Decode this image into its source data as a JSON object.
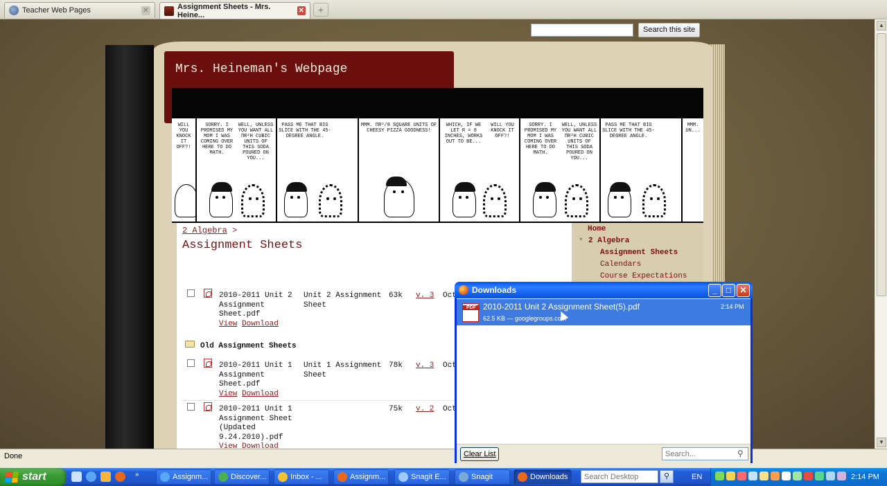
{
  "browser": {
    "tabs": [
      {
        "label": "Teacher Web Pages",
        "active": false
      },
      {
        "label": "Assignment Sheets - Mrs. Heine...",
        "active": true
      }
    ],
    "new_tab_label": "+",
    "status": "Done"
  },
  "site": {
    "search_button": "Search this site",
    "title": "Mrs. Heineman's Webpage",
    "comic_panels": [
      "will you knock it off?!",
      "Sorry. I promised my mom I was coming over here to do math.",
      "Well, unless you want all πr²h cubic units of this soda poured on you...",
      "Pass me that big slice with the 45-degree angle.",
      "Mmm. πr²/8 square units of cheesy pizza goodness!",
      "Which, if we let r = 8 inches, works out to be...",
      "Will you knock it off?!",
      "Sorry. I promised my mom I was coming over here to do math.",
      "Well, unless you want all πr²h cubic units of this soda poured on you...",
      "Pass me that big slice with the 45-degree angle.",
      "Mmm. un..."
    ]
  },
  "breadcrumb": {
    "parent": "2 Algebra",
    "separator": ">"
  },
  "page_title": "Assignment Sheets",
  "files": [
    {
      "name_lines": [
        "2010-2011 Unit 2",
        "Assignment",
        "Sheet.pdf"
      ],
      "desc_lines": [
        "Unit 2 Assignment",
        "Sheet"
      ],
      "size": "63k",
      "version": "v. 3",
      "date": "Oct",
      "view": "View",
      "download": "Download"
    }
  ],
  "folder": {
    "label": "Old Assignment Sheets"
  },
  "old_files": [
    {
      "name_lines": [
        "2010-2011 Unit 1",
        "Assignment",
        "Sheet.pdf"
      ],
      "desc_lines": [
        "Unit 1 Assignment",
        "Sheet"
      ],
      "size": "78k",
      "version": "v. 3",
      "date": "Oct",
      "view": "View",
      "download": "Download"
    },
    {
      "name_lines": [
        "2010-2011 Unit 1",
        "Assignment Sheet",
        "(Updated",
        "9.24.2010).pdf"
      ],
      "desc_lines": [],
      "size": "75k",
      "version": "v. 2",
      "date": "Oct",
      "view": "View",
      "download": "Download"
    }
  ],
  "nav": {
    "home": "Home",
    "section": "2 Algebra",
    "items": [
      "Assignment Sheets",
      "Calendars",
      "Course Expectations"
    ]
  },
  "downloads": {
    "title": "Downloads",
    "item": {
      "filename": "2010-2011 Unit 2 Assignment Sheet(5).pdf",
      "meta": "62.5 KB — googlegroups.com",
      "time": "2:14 PM",
      "icon_label": "PDF"
    },
    "clear_button": "Clear List",
    "search_placeholder": "Search..."
  },
  "taskbar": {
    "start": "start",
    "tasks": [
      "Assignm...",
      "Discover...",
      "Inbox - ...",
      "Assignm...",
      "Snagit E...",
      "Snagit",
      "Downloads"
    ],
    "desktop_search_placeholder": "Search Desktop",
    "language": "EN",
    "clock": "2:14 PM"
  }
}
